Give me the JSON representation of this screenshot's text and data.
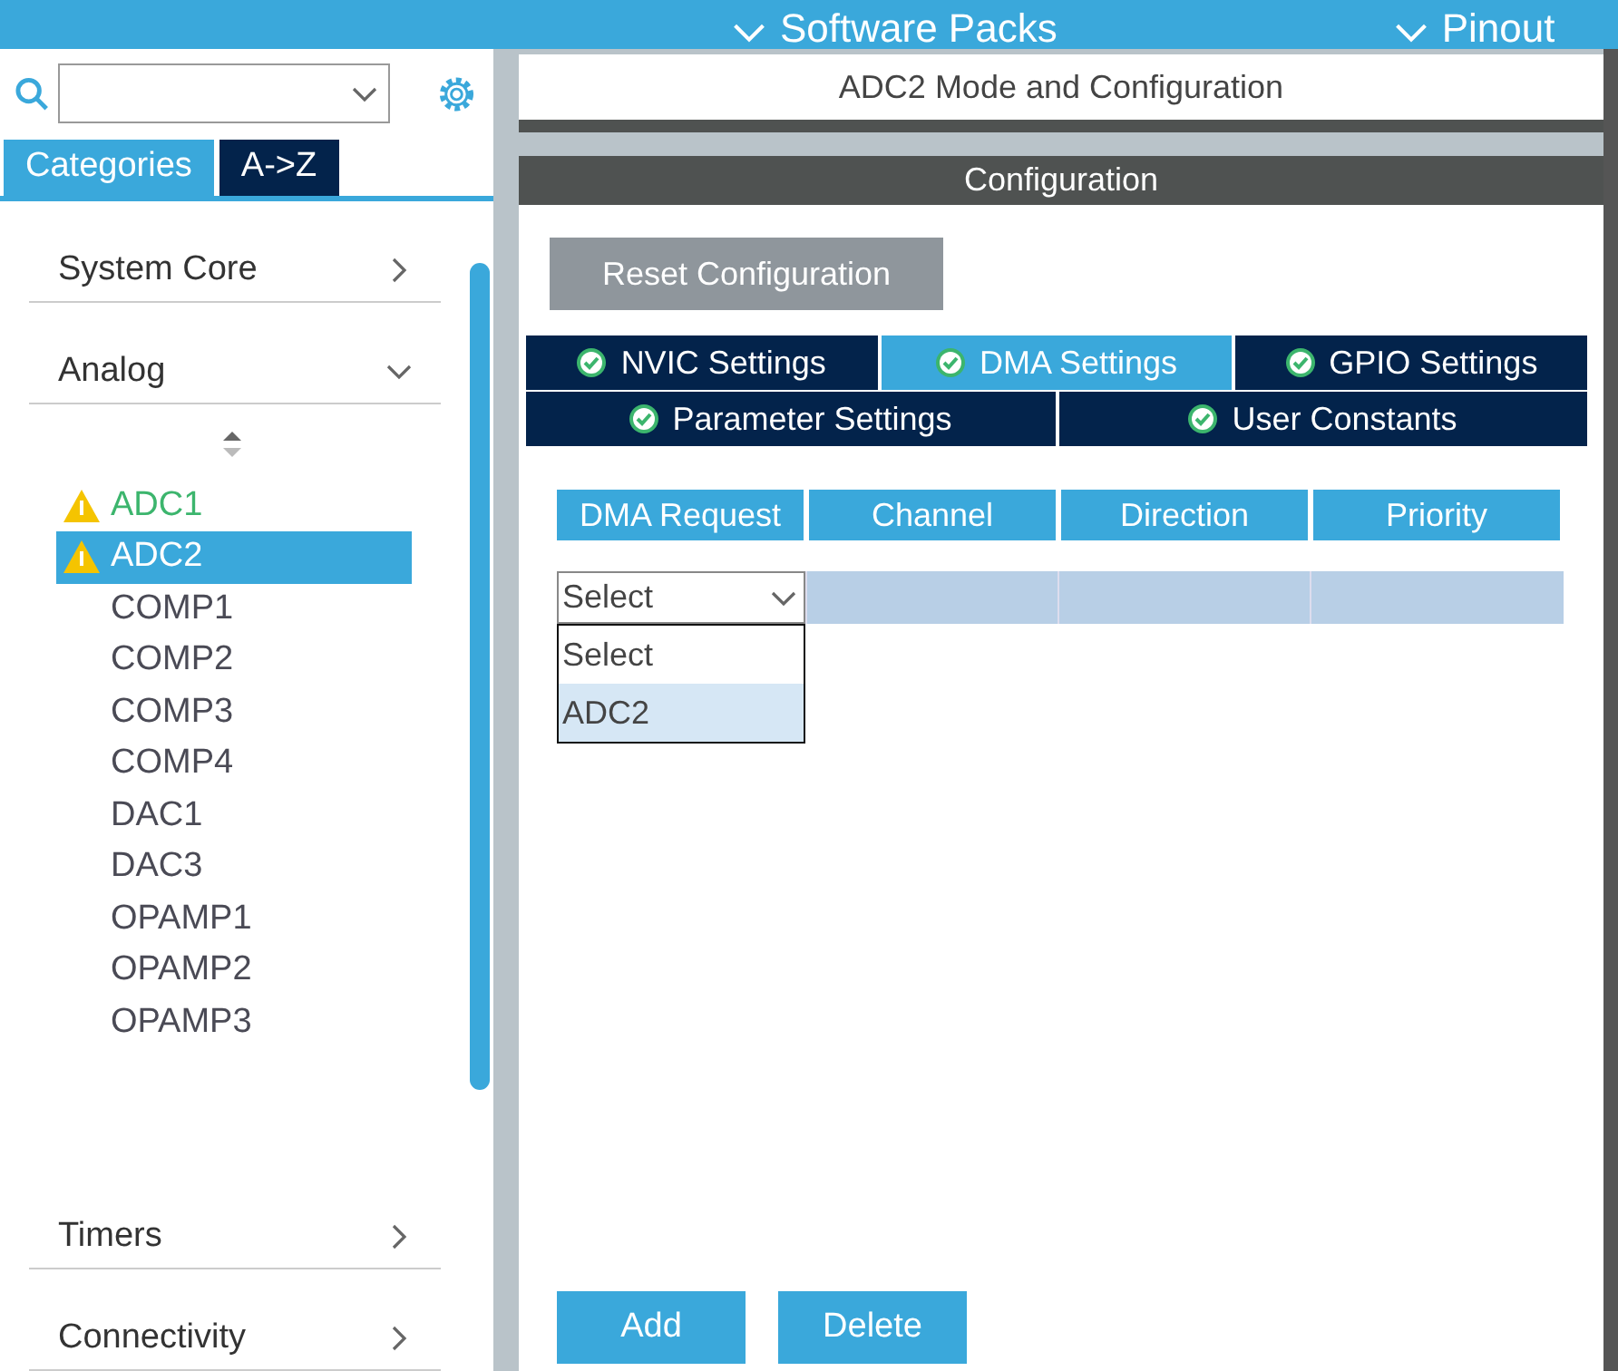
{
  "top_bar": {
    "menus": [
      {
        "label": "Software Packs"
      },
      {
        "label": "Pinout"
      }
    ]
  },
  "sidebar": {
    "tabs": [
      {
        "label": "Categories",
        "selected": true
      },
      {
        "label": "A->Z",
        "selected": false
      }
    ],
    "categories": [
      {
        "label": "System Core",
        "expanded": false
      },
      {
        "label": "Analog",
        "expanded": true,
        "children": [
          {
            "label": "ADC1",
            "warning": true,
            "configured": true,
            "selected": false
          },
          {
            "label": "ADC2",
            "warning": true,
            "configured": false,
            "selected": true
          },
          {
            "label": "COMP1",
            "warning": false,
            "configured": false,
            "selected": false
          },
          {
            "label": "COMP2",
            "warning": false,
            "configured": false,
            "selected": false
          },
          {
            "label": "COMP3",
            "warning": false,
            "configured": false,
            "selected": false
          },
          {
            "label": "COMP4",
            "warning": false,
            "configured": false,
            "selected": false
          },
          {
            "label": "DAC1",
            "warning": false,
            "configured": false,
            "selected": false
          },
          {
            "label": "DAC3",
            "warning": false,
            "configured": false,
            "selected": false
          },
          {
            "label": "OPAMP1",
            "warning": false,
            "configured": false,
            "selected": false
          },
          {
            "label": "OPAMP2",
            "warning": false,
            "configured": false,
            "selected": false
          },
          {
            "label": "OPAMP3",
            "warning": false,
            "configured": false,
            "selected": false
          }
        ]
      },
      {
        "label": "Timers",
        "expanded": false
      },
      {
        "label": "Connectivity",
        "expanded": false
      }
    ]
  },
  "panel": {
    "title": "ADC2 Mode and Configuration",
    "section": "Configuration",
    "reset_button": "Reset Configuration",
    "tab_rows": [
      [
        {
          "label": "NVIC Settings",
          "selected": false
        },
        {
          "label": "DMA Settings",
          "selected": true
        },
        {
          "label": "GPIO Settings",
          "selected": false
        }
      ],
      [
        {
          "label": "Parameter Settings",
          "selected": false
        },
        {
          "label": "User Constants",
          "selected": false
        }
      ]
    ],
    "table": {
      "columns": [
        "DMA Request",
        "Channel",
        "Direction",
        "Priority"
      ],
      "row": {
        "select_value": "Select",
        "options": [
          {
            "label": "Select",
            "selected": false
          },
          {
            "label": "ADC2",
            "selected": true
          }
        ]
      }
    },
    "buttons": [
      "Add",
      "Delete"
    ]
  }
}
